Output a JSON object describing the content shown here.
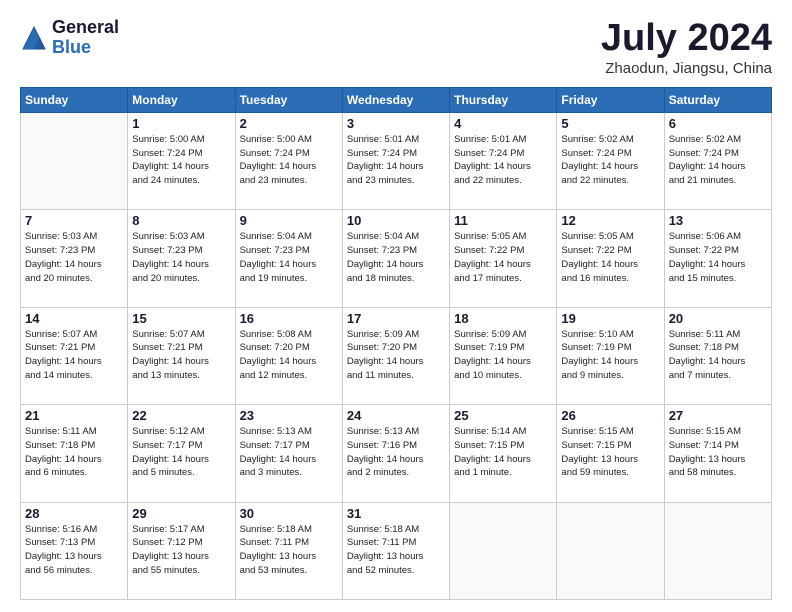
{
  "header": {
    "logo_general": "General",
    "logo_blue": "Blue",
    "month_title": "July 2024",
    "location": "Zhaodun, Jiangsu, China"
  },
  "weekdays": [
    "Sunday",
    "Monday",
    "Tuesday",
    "Wednesday",
    "Thursday",
    "Friday",
    "Saturday"
  ],
  "weeks": [
    [
      {
        "day": "",
        "info": ""
      },
      {
        "day": "1",
        "info": "Sunrise: 5:00 AM\nSunset: 7:24 PM\nDaylight: 14 hours\nand 24 minutes."
      },
      {
        "day": "2",
        "info": "Sunrise: 5:00 AM\nSunset: 7:24 PM\nDaylight: 14 hours\nand 23 minutes."
      },
      {
        "day": "3",
        "info": "Sunrise: 5:01 AM\nSunset: 7:24 PM\nDaylight: 14 hours\nand 23 minutes."
      },
      {
        "day": "4",
        "info": "Sunrise: 5:01 AM\nSunset: 7:24 PM\nDaylight: 14 hours\nand 22 minutes."
      },
      {
        "day": "5",
        "info": "Sunrise: 5:02 AM\nSunset: 7:24 PM\nDaylight: 14 hours\nand 22 minutes."
      },
      {
        "day": "6",
        "info": "Sunrise: 5:02 AM\nSunset: 7:24 PM\nDaylight: 14 hours\nand 21 minutes."
      }
    ],
    [
      {
        "day": "7",
        "info": "Sunrise: 5:03 AM\nSunset: 7:23 PM\nDaylight: 14 hours\nand 20 minutes."
      },
      {
        "day": "8",
        "info": "Sunrise: 5:03 AM\nSunset: 7:23 PM\nDaylight: 14 hours\nand 20 minutes."
      },
      {
        "day": "9",
        "info": "Sunrise: 5:04 AM\nSunset: 7:23 PM\nDaylight: 14 hours\nand 19 minutes."
      },
      {
        "day": "10",
        "info": "Sunrise: 5:04 AM\nSunset: 7:23 PM\nDaylight: 14 hours\nand 18 minutes."
      },
      {
        "day": "11",
        "info": "Sunrise: 5:05 AM\nSunset: 7:22 PM\nDaylight: 14 hours\nand 17 minutes."
      },
      {
        "day": "12",
        "info": "Sunrise: 5:05 AM\nSunset: 7:22 PM\nDaylight: 14 hours\nand 16 minutes."
      },
      {
        "day": "13",
        "info": "Sunrise: 5:06 AM\nSunset: 7:22 PM\nDaylight: 14 hours\nand 15 minutes."
      }
    ],
    [
      {
        "day": "14",
        "info": "Sunrise: 5:07 AM\nSunset: 7:21 PM\nDaylight: 14 hours\nand 14 minutes."
      },
      {
        "day": "15",
        "info": "Sunrise: 5:07 AM\nSunset: 7:21 PM\nDaylight: 14 hours\nand 13 minutes."
      },
      {
        "day": "16",
        "info": "Sunrise: 5:08 AM\nSunset: 7:20 PM\nDaylight: 14 hours\nand 12 minutes."
      },
      {
        "day": "17",
        "info": "Sunrise: 5:09 AM\nSunset: 7:20 PM\nDaylight: 14 hours\nand 11 minutes."
      },
      {
        "day": "18",
        "info": "Sunrise: 5:09 AM\nSunset: 7:19 PM\nDaylight: 14 hours\nand 10 minutes."
      },
      {
        "day": "19",
        "info": "Sunrise: 5:10 AM\nSunset: 7:19 PM\nDaylight: 14 hours\nand 9 minutes."
      },
      {
        "day": "20",
        "info": "Sunrise: 5:11 AM\nSunset: 7:18 PM\nDaylight: 14 hours\nand 7 minutes."
      }
    ],
    [
      {
        "day": "21",
        "info": "Sunrise: 5:11 AM\nSunset: 7:18 PM\nDaylight: 14 hours\nand 6 minutes."
      },
      {
        "day": "22",
        "info": "Sunrise: 5:12 AM\nSunset: 7:17 PM\nDaylight: 14 hours\nand 5 minutes."
      },
      {
        "day": "23",
        "info": "Sunrise: 5:13 AM\nSunset: 7:17 PM\nDaylight: 14 hours\nand 3 minutes."
      },
      {
        "day": "24",
        "info": "Sunrise: 5:13 AM\nSunset: 7:16 PM\nDaylight: 14 hours\nand 2 minutes."
      },
      {
        "day": "25",
        "info": "Sunrise: 5:14 AM\nSunset: 7:15 PM\nDaylight: 14 hours\nand 1 minute."
      },
      {
        "day": "26",
        "info": "Sunrise: 5:15 AM\nSunset: 7:15 PM\nDaylight: 13 hours\nand 59 minutes."
      },
      {
        "day": "27",
        "info": "Sunrise: 5:15 AM\nSunset: 7:14 PM\nDaylight: 13 hours\nand 58 minutes."
      }
    ],
    [
      {
        "day": "28",
        "info": "Sunrise: 5:16 AM\nSunset: 7:13 PM\nDaylight: 13 hours\nand 56 minutes."
      },
      {
        "day": "29",
        "info": "Sunrise: 5:17 AM\nSunset: 7:12 PM\nDaylight: 13 hours\nand 55 minutes."
      },
      {
        "day": "30",
        "info": "Sunrise: 5:18 AM\nSunset: 7:11 PM\nDaylight: 13 hours\nand 53 minutes."
      },
      {
        "day": "31",
        "info": "Sunrise: 5:18 AM\nSunset: 7:11 PM\nDaylight: 13 hours\nand 52 minutes."
      },
      {
        "day": "",
        "info": ""
      },
      {
        "day": "",
        "info": ""
      },
      {
        "day": "",
        "info": ""
      }
    ]
  ]
}
